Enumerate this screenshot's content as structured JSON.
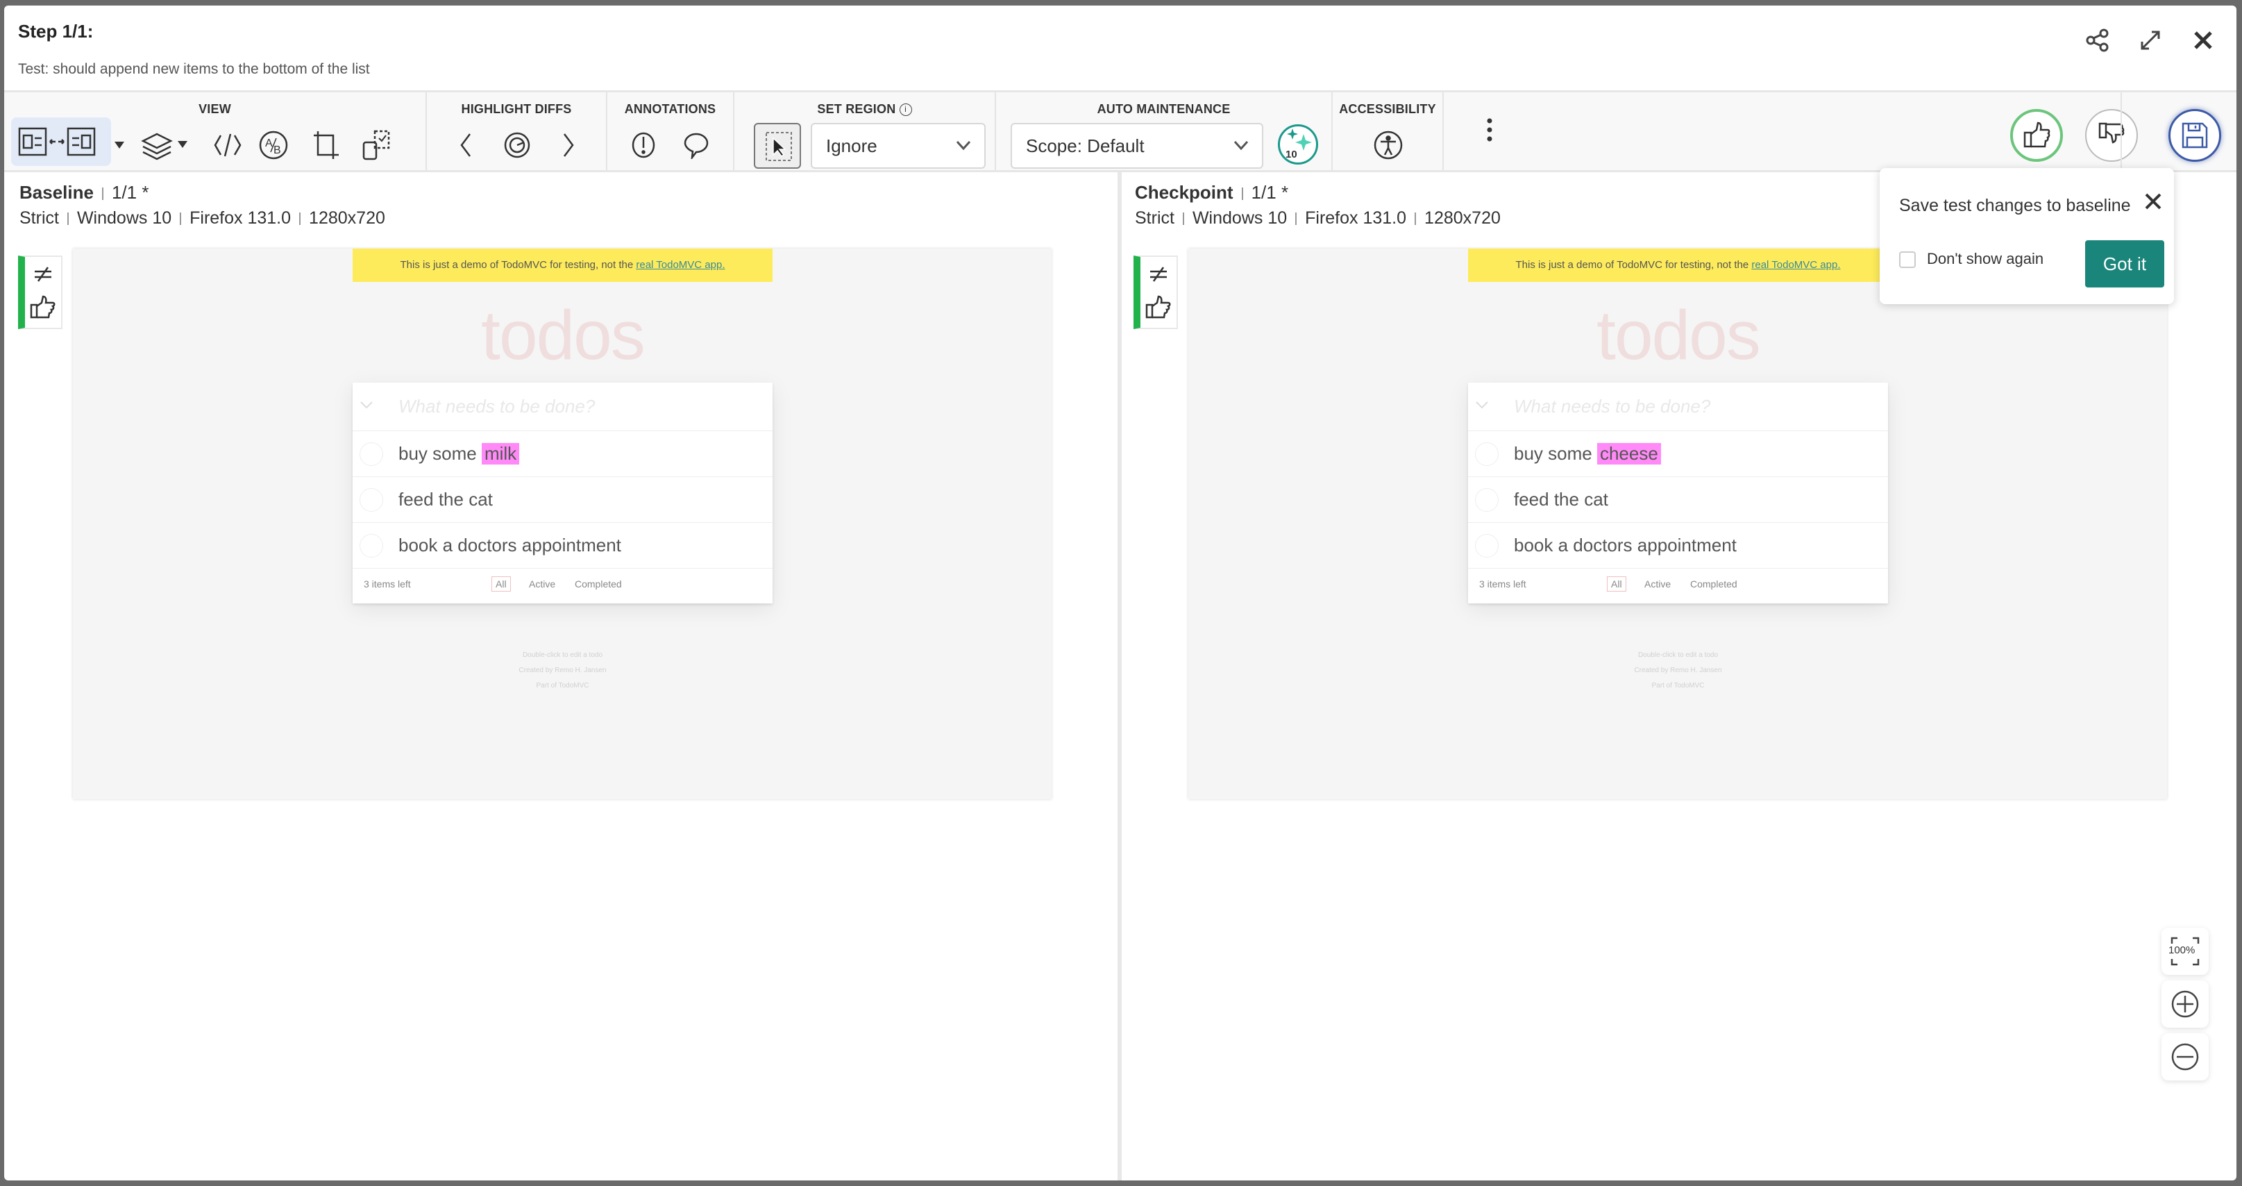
{
  "header": {
    "title": "Step 1/1:",
    "subtitle": "Test: should append new items to the bottom of the list",
    "icons": [
      "share-icon",
      "expand-icon",
      "close-icon"
    ]
  },
  "toolbar": {
    "groups": {
      "view": "VIEW",
      "highlight": "HIGHLIGHT DIFFS",
      "annotations": "ANNOTATIONS",
      "set_region": "SET REGION",
      "auto_maintenance": "AUTO MAINTENANCE",
      "accessibility": "ACCESSIBILITY"
    },
    "region_select": "Ignore",
    "scope_select": "Scope: Default",
    "auto_count": "10"
  },
  "colors": {
    "accent": "#1a857a",
    "approve": "#6cc57c",
    "save": "#3c5aa6",
    "diff_highlight": "#ff8af7",
    "banner": "#fdeb5b",
    "marker": "#22b24c"
  },
  "baseline": {
    "label": "Baseline",
    "step": "1/1",
    "star": "*",
    "meta": [
      "Strict",
      "Windows 10",
      "Firefox 131.0",
      "1280x720"
    ]
  },
  "checkpoint": {
    "label": "Checkpoint",
    "step": "1/1",
    "star": "*",
    "meta": [
      "Strict",
      "Windows 10",
      "Firefox 131.0",
      "1280x720"
    ]
  },
  "app_baseline": {
    "banner": "This is just a demo of TodoMVC for testing, not the ",
    "banner_link": "real TodoMVC app.",
    "heading": "todos",
    "placeholder": "What needs to be done?",
    "item1_prefix": "buy some ",
    "item1_diff": "milk",
    "item2": "feed the cat",
    "item3": "book a doctors appointment",
    "count": "3 items left",
    "filters": [
      "All",
      "Active",
      "Completed"
    ],
    "info": [
      "Double-click to edit a todo",
      "Created by Remo H. Jansen",
      "Part of TodoMVC"
    ]
  },
  "app_checkpoint": {
    "banner": "This is just a demo of TodoMVC for testing, not the ",
    "banner_link": "real TodoMVC app.",
    "heading": "todos",
    "placeholder": "What needs to be done?",
    "item1_prefix": "buy some ",
    "item1_diff": "cheese",
    "item2": "feed the cat",
    "item3": "book a doctors appointment",
    "count": "3 items left",
    "filters": [
      "All",
      "Active",
      "Completed"
    ],
    "info": [
      "Double-click to edit a todo",
      "Created by Remo H. Jansen",
      "Part of TodoMVC"
    ]
  },
  "popover": {
    "title": "Save test changes to baseline",
    "checkbox_label": "Don't show again",
    "checked": false,
    "button": "Got it"
  },
  "zoom": {
    "fit_label": "100%"
  }
}
